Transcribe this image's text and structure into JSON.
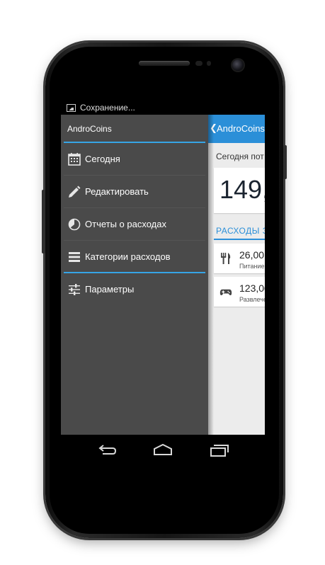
{
  "status_bar": {
    "text": "Сохранение...",
    "icon": "image-icon"
  },
  "drawer": {
    "title": "AndroCoins",
    "items": [
      {
        "label": "Сегодня",
        "icon": "calendar-icon"
      },
      {
        "label": "Редактировать",
        "icon": "pencil-icon"
      },
      {
        "label": "Отчеты о расходах",
        "icon": "pie-chart-icon"
      },
      {
        "label": "Категории расходов",
        "icon": "list-icon"
      },
      {
        "label": "Параметры",
        "icon": "sliders-icon"
      }
    ]
  },
  "main": {
    "actionbar_title": "AndroCoins",
    "today_label": "Сегодня пот",
    "amount": "149,",
    "section_title": "РАСХОДЫ З",
    "expenses": [
      {
        "value": "26,00",
        "category": "Питание",
        "icon": "fork-knife-icon"
      },
      {
        "value": "123,00",
        "category": "Развлече",
        "icon": "gamepad-icon"
      }
    ]
  },
  "nav_bar": {
    "back": "back-icon",
    "home": "home-icon",
    "recents": "recents-icon"
  },
  "colors": {
    "accent": "#2b8fd8",
    "drawer_bg": "#4a4a4a",
    "divider": "#36a5e6"
  }
}
